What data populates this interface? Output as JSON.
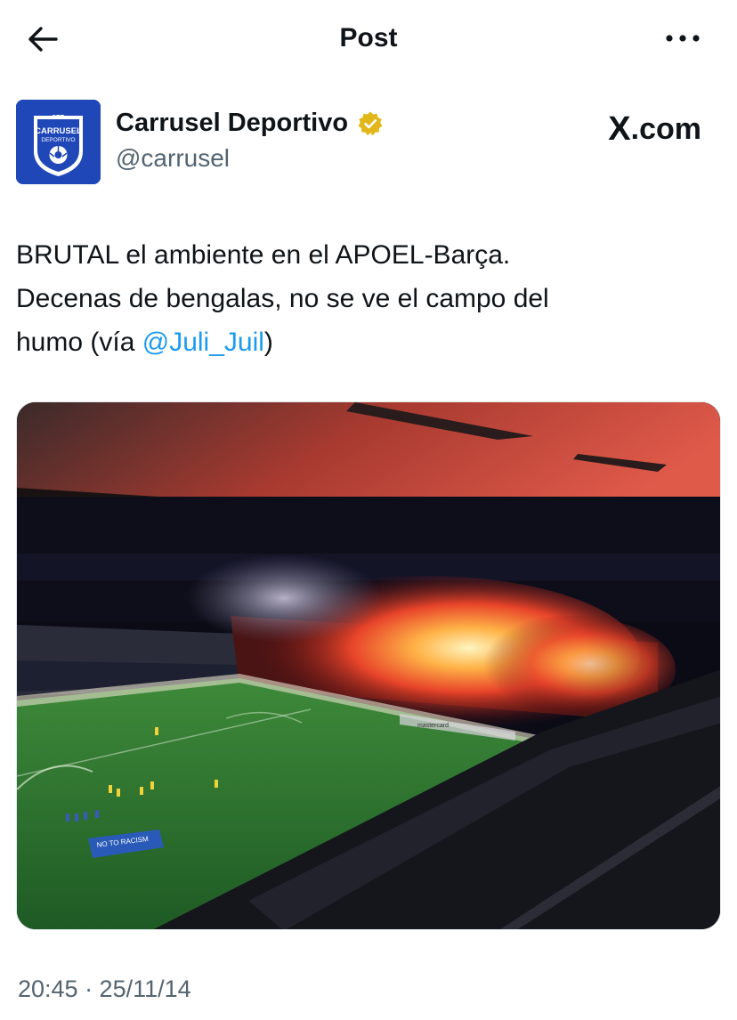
{
  "topbar": {
    "title": "Post",
    "back_icon": "arrow-left-icon",
    "more_icon": "more-horizontal-icon"
  },
  "author": {
    "display_name": "Carrusel Deportivo",
    "handle": "@carrusel",
    "verified_badge": "gold-verified-icon",
    "avatar_text_top": "SER",
    "avatar_text_main": "CARRUSEL",
    "avatar_text_sub": "DEPORTIVO"
  },
  "source": {
    "logo": "X",
    "domain": ".com"
  },
  "post": {
    "text_line1": "BRUTAL el ambiente en el APOEL-Barça.",
    "text_line2": "Decenas de bengalas, no se ve el campo del",
    "text_line3_start": "humo (vía ",
    "mention": "@Juli_Juil",
    "text_line3_end": ")"
  },
  "media": {
    "banner_text": "NO TO RACISM",
    "board_text": "mastercard"
  },
  "meta": {
    "timestamp": "20:45 · 25/11/14"
  },
  "colors": {
    "text_primary": "#0f1419",
    "text_secondary": "#536471",
    "link": "#1d9bf0",
    "avatar_bg": "#1f47b8",
    "verified_gold": "#e2b719"
  }
}
